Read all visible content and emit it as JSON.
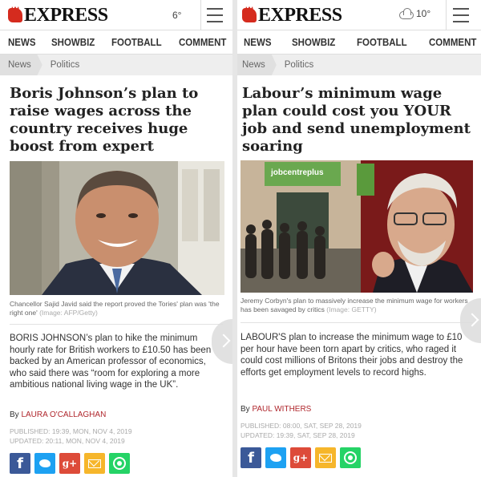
{
  "left": {
    "masthead": {
      "logo_text": "EXPRESS",
      "weather": "6°"
    },
    "nav": [
      "NEWS",
      "SHOWBIZ",
      "FOOTBALL",
      "COMMENT"
    ],
    "breadcrumb": [
      "News",
      "Politics"
    ],
    "headline": "Boris Johnson’s plan to raise wages across the country receives huge boost from expert",
    "caption": "Chancellor Sajid Javid said the report proved the Tories' plan was 'the right one'",
    "caption_credit": "(Image: AFP/Getty)",
    "body": "BORIS JOHNSON’s plan to hike the minimum hourly rate for British workers to £10.50 has been backed by an American professor of economics, who said there was “room for exploring a more ambitious national living wage in the UK”.",
    "byline_prefix": "By",
    "author": "LAURA O'CALLAGHAN",
    "published": "PUBLISHED: 19:39, Mon, Nov 4, 2019",
    "updated": "UPDATED: 20:11, Mon, Nov 4, 2019"
  },
  "right": {
    "masthead": {
      "logo_text": "EXPRESS",
      "weather": "10°"
    },
    "nav": [
      "NEWS",
      "SHOWBIZ",
      "FOOTBALL",
      "COMMENT"
    ],
    "breadcrumb": [
      "News",
      "Politics"
    ],
    "headline": "Labour’s minimum wage plan could cost you YOUR job and send unemployment soaring",
    "photo_sign": "jobcentreplus",
    "caption": "Jeremy Corbyn's plan to massively increase the minimum wage for workers has been savaged by critics",
    "caption_credit": "(Image: GETTY)",
    "body": "LABOUR'S plan to increase the minimum wage to £10 per hour have been torn apart by critics, who raged it could cost millions of Britons their jobs and destroy the efforts get employment levels to record highs.",
    "byline_prefix": "By",
    "author": "PAUL WITHERS",
    "published": "PUBLISHED: 08:00, Sat, Sep 28, 2019",
    "updated": "UPDATED: 19:39, Sat, Sep 28, 2019"
  },
  "share_icons": [
    "facebook-icon",
    "twitter-icon",
    "google-plus-icon",
    "email-icon",
    "whatsapp-icon"
  ],
  "share_glyphs": {
    "facebook": "f",
    "google_plus": "g+"
  },
  "colors": {
    "logo_red": "#d52b1e",
    "author_red": "#b0272d",
    "facebook": "#3b5998",
    "twitter": "#1da1f2",
    "google_plus": "#dd4b39",
    "email": "#f6b62b",
    "whatsapp": "#25d366"
  }
}
